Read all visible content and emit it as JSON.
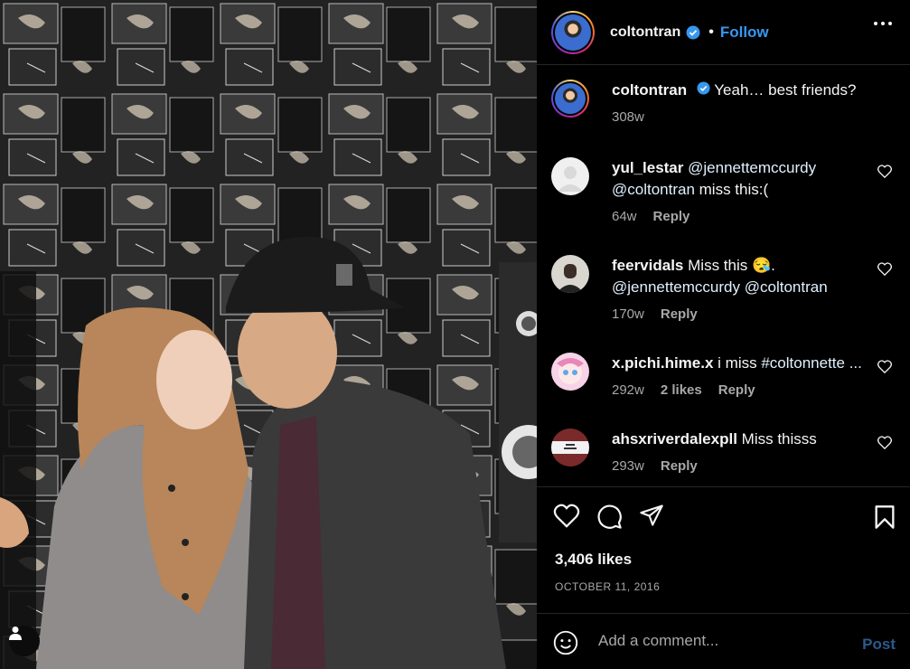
{
  "post": {
    "author": "coltontran",
    "follow_label": "Follow",
    "separator": "•",
    "caption": {
      "username": "coltontran",
      "text": "Yeah… best friends?",
      "age": "308w"
    },
    "comments": [
      {
        "username": "yul_lestar",
        "text_parts": [
          "@jennettemccurdy",
          "@coltontran",
          " miss this:("
        ],
        "age": "64w",
        "likes": "",
        "reply_label": "Reply"
      },
      {
        "username": "feervidals",
        "text_parts": [
          "Miss this 😪.",
          "@jennettemccurdy",
          "@coltontran"
        ],
        "age": "170w",
        "likes": "",
        "reply_label": "Reply"
      },
      {
        "username": "x.pichi.hime.x",
        "text_parts": [
          "i miss ",
          "#coltonnette ..."
        ],
        "age": "292w",
        "likes": "2 likes",
        "reply_label": "Reply"
      },
      {
        "username": "ahsxriverdalexpll",
        "text_parts": [
          "Miss thisss"
        ],
        "age": "293w",
        "likes": "",
        "reply_label": "Reply"
      }
    ],
    "likes_count": "3,406 likes",
    "date": "OCTOBER 11, 2016",
    "add_comment_placeholder": "Add a comment...",
    "post_label": "Post"
  },
  "icons": {
    "verified": "verified-badge-icon",
    "more": "more-options-icon",
    "like": "heart-icon",
    "comment": "comment-icon",
    "share": "share-icon",
    "save": "bookmark-icon",
    "emoji": "emoji-icon",
    "tagged_user": "user-tag-icon"
  },
  "colors": {
    "background": "#000000",
    "link": "#3797f0",
    "muted": "#a8a8a8",
    "post_disabled": "#2b5a8b"
  }
}
